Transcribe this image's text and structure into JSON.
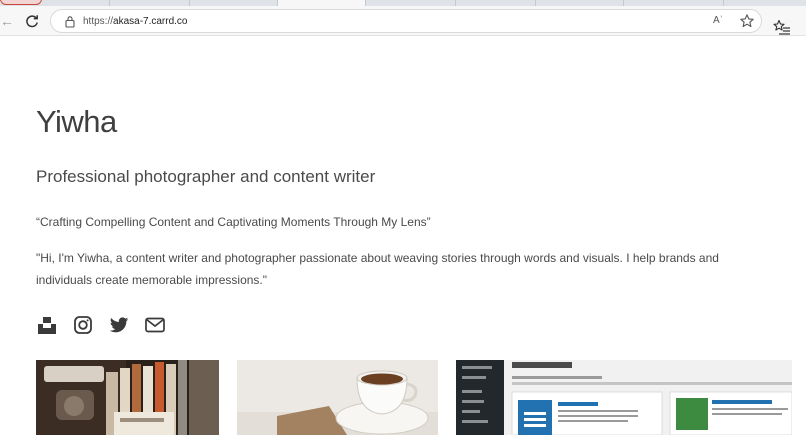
{
  "browser": {
    "url_scheme": "https://",
    "url_host": "akasa-7.carrd.co",
    "read_aloud_label": "Aʾ",
    "back_icon": "back-arrow-icon",
    "reload_icon": "reload-icon",
    "lock_icon": "lock-icon",
    "favorite_icon": "star-icon",
    "favorites_icon": "favorites-icon"
  },
  "page": {
    "name": "Yiwha",
    "tagline": "Professional photographer and content writer",
    "quote": "“Crafting Compelling Content and Captivating Moments Through My Lens”",
    "bio": "\"Hi, I'm Yiwha, a content writer and photographer passionate about weaving stories through words and visuals. I help brands and individuals create memorable impressions.\""
  },
  "socials": [
    {
      "icon": "unsplash-icon"
    },
    {
      "icon": "instagram-icon"
    },
    {
      "icon": "twitter-icon"
    },
    {
      "icon": "email-icon"
    }
  ],
  "gallery": [
    {
      "icon": "photo-books-desk"
    },
    {
      "icon": "photo-coffee-cup"
    },
    {
      "icon": "photo-wordpress-plugins"
    }
  ],
  "colors": {
    "text": "#4a4a4a",
    "heading": "#3f3f3f",
    "icon": "#3a3a3a"
  }
}
